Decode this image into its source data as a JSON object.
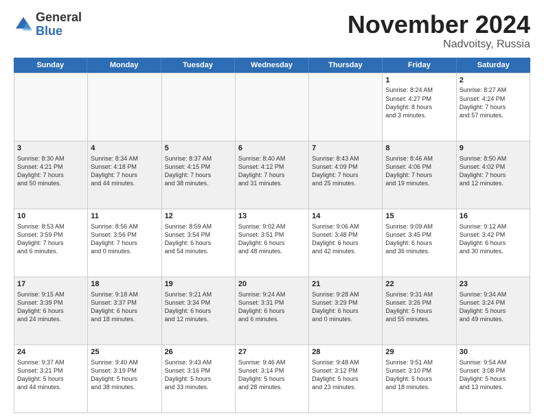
{
  "logo": {
    "general": "General",
    "blue": "Blue"
  },
  "title": "November 2024",
  "location": "Nadvoitsy, Russia",
  "header_days": [
    "Sunday",
    "Monday",
    "Tuesday",
    "Wednesday",
    "Thursday",
    "Friday",
    "Saturday"
  ],
  "weeks": [
    [
      {
        "day": "",
        "info": "",
        "empty": true
      },
      {
        "day": "",
        "info": "",
        "empty": true
      },
      {
        "day": "",
        "info": "",
        "empty": true
      },
      {
        "day": "",
        "info": "",
        "empty": true
      },
      {
        "day": "",
        "info": "",
        "empty": true
      },
      {
        "day": "1",
        "info": "Sunrise: 8:24 AM\nSunset: 4:27 PM\nDaylight: 8 hours\nand 3 minutes."
      },
      {
        "day": "2",
        "info": "Sunrise: 8:27 AM\nSunset: 4:24 PM\nDaylight: 7 hours\nand 57 minutes."
      }
    ],
    [
      {
        "day": "3",
        "info": "Sunrise: 8:30 AM\nSunset: 4:21 PM\nDaylight: 7 hours\nand 50 minutes."
      },
      {
        "day": "4",
        "info": "Sunrise: 8:34 AM\nSunset: 4:18 PM\nDaylight: 7 hours\nand 44 minutes."
      },
      {
        "day": "5",
        "info": "Sunrise: 8:37 AM\nSunset: 4:15 PM\nDaylight: 7 hours\nand 38 minutes."
      },
      {
        "day": "6",
        "info": "Sunrise: 8:40 AM\nSunset: 4:12 PM\nDaylight: 7 hours\nand 31 minutes."
      },
      {
        "day": "7",
        "info": "Sunrise: 8:43 AM\nSunset: 4:09 PM\nDaylight: 7 hours\nand 25 minutes."
      },
      {
        "day": "8",
        "info": "Sunrise: 8:46 AM\nSunset: 4:06 PM\nDaylight: 7 hours\nand 19 minutes."
      },
      {
        "day": "9",
        "info": "Sunrise: 8:50 AM\nSunset: 4:02 PM\nDaylight: 7 hours\nand 12 minutes."
      }
    ],
    [
      {
        "day": "10",
        "info": "Sunrise: 8:53 AM\nSunset: 3:59 PM\nDaylight: 7 hours\nand 6 minutes."
      },
      {
        "day": "11",
        "info": "Sunrise: 8:56 AM\nSunset: 3:56 PM\nDaylight: 7 hours\nand 0 minutes."
      },
      {
        "day": "12",
        "info": "Sunrise: 8:59 AM\nSunset: 3:54 PM\nDaylight: 6 hours\nand 54 minutes."
      },
      {
        "day": "13",
        "info": "Sunrise: 9:02 AM\nSunset: 3:51 PM\nDaylight: 6 hours\nand 48 minutes."
      },
      {
        "day": "14",
        "info": "Sunrise: 9:06 AM\nSunset: 3:48 PM\nDaylight: 6 hours\nand 42 minutes."
      },
      {
        "day": "15",
        "info": "Sunrise: 9:09 AM\nSunset: 3:45 PM\nDaylight: 6 hours\nand 36 minutes."
      },
      {
        "day": "16",
        "info": "Sunrise: 9:12 AM\nSunset: 3:42 PM\nDaylight: 6 hours\nand 30 minutes."
      }
    ],
    [
      {
        "day": "17",
        "info": "Sunrise: 9:15 AM\nSunset: 3:39 PM\nDaylight: 6 hours\nand 24 minutes."
      },
      {
        "day": "18",
        "info": "Sunrise: 9:18 AM\nSunset: 3:37 PM\nDaylight: 6 hours\nand 18 minutes."
      },
      {
        "day": "19",
        "info": "Sunrise: 9:21 AM\nSunset: 3:34 PM\nDaylight: 6 hours\nand 12 minutes."
      },
      {
        "day": "20",
        "info": "Sunrise: 9:24 AM\nSunset: 3:31 PM\nDaylight: 6 hours\nand 6 minutes."
      },
      {
        "day": "21",
        "info": "Sunrise: 9:28 AM\nSunset: 3:29 PM\nDaylight: 6 hours\nand 0 minutes."
      },
      {
        "day": "22",
        "info": "Sunrise: 9:31 AM\nSunset: 3:26 PM\nDaylight: 5 hours\nand 55 minutes."
      },
      {
        "day": "23",
        "info": "Sunrise: 9:34 AM\nSunset: 3:24 PM\nDaylight: 5 hours\nand 49 minutes."
      }
    ],
    [
      {
        "day": "24",
        "info": "Sunrise: 9:37 AM\nSunset: 3:21 PM\nDaylight: 5 hours\nand 44 minutes."
      },
      {
        "day": "25",
        "info": "Sunrise: 9:40 AM\nSunset: 3:19 PM\nDaylight: 5 hours\nand 38 minutes."
      },
      {
        "day": "26",
        "info": "Sunrise: 9:43 AM\nSunset: 3:16 PM\nDaylight: 5 hours\nand 33 minutes."
      },
      {
        "day": "27",
        "info": "Sunrise: 9:46 AM\nSunset: 3:14 PM\nDaylight: 5 hours\nand 28 minutes."
      },
      {
        "day": "28",
        "info": "Sunrise: 9:48 AM\nSunset: 3:12 PM\nDaylight: 5 hours\nand 23 minutes."
      },
      {
        "day": "29",
        "info": "Sunrise: 9:51 AM\nSunset: 3:10 PM\nDaylight: 5 hours\nand 18 minutes."
      },
      {
        "day": "30",
        "info": "Sunrise: 9:54 AM\nSunset: 3:08 PM\nDaylight: 5 hours\nand 13 minutes."
      }
    ]
  ]
}
